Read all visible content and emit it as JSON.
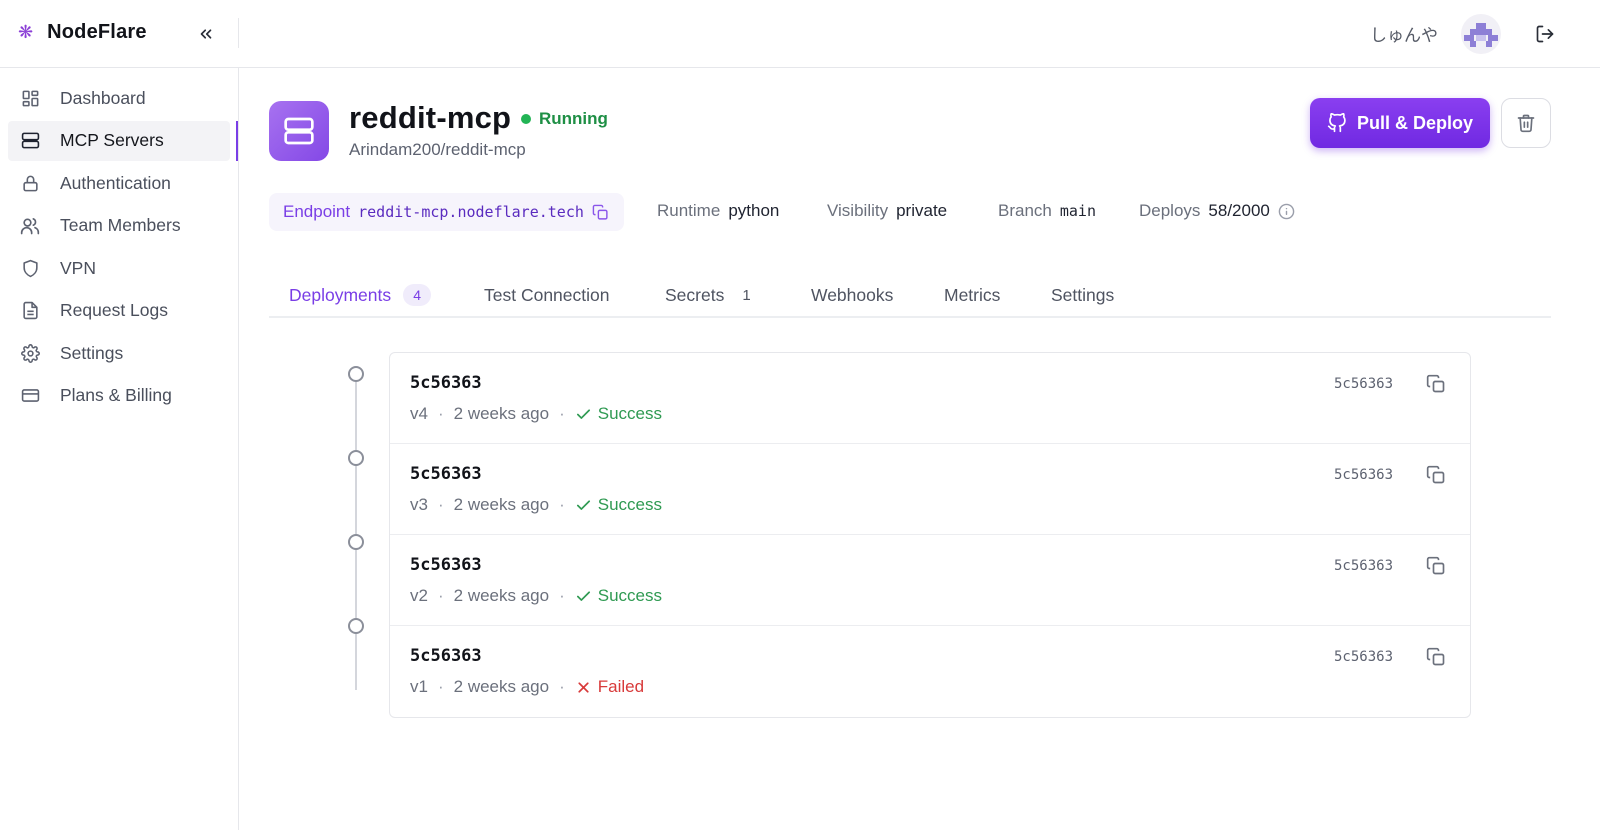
{
  "app": {
    "brand": "NodeFlare",
    "user_name": "しゅんや"
  },
  "sidebar": {
    "items": [
      {
        "label": "Dashboard",
        "icon": "dashboard-icon"
      },
      {
        "label": "MCP Servers",
        "icon": "server-icon",
        "active": true
      },
      {
        "label": "Authentication",
        "icon": "lock-icon"
      },
      {
        "label": "Team Members",
        "icon": "users-icon"
      },
      {
        "label": "VPN",
        "icon": "shield-icon"
      },
      {
        "label": "Request Logs",
        "icon": "file-text-icon"
      },
      {
        "label": "Settings",
        "icon": "gear-icon"
      },
      {
        "label": "Plans & Billing",
        "icon": "credit-card-icon"
      }
    ]
  },
  "server": {
    "name": "reddit-mcp",
    "status": "Running",
    "repo": "Arindam200/reddit-mcp",
    "deploy_button": "Pull & Deploy",
    "meta": {
      "endpoint_label": "Endpoint",
      "endpoint_value": "reddit-mcp.nodeflare.tech",
      "runtime_label": "Runtime",
      "runtime_value": "python",
      "visibility_label": "Visibility",
      "visibility_value": "private",
      "branch_label": "Branch",
      "branch_value": "main",
      "deploys_label": "Deploys",
      "deploys_value": "58/2000"
    }
  },
  "tabs": [
    {
      "label": "Deployments",
      "count": "4",
      "active": true
    },
    {
      "label": "Test Connection"
    },
    {
      "label": "Secrets",
      "count": "1"
    },
    {
      "label": "Webhooks"
    },
    {
      "label": "Metrics"
    },
    {
      "label": "Settings"
    }
  ],
  "deployments": [
    {
      "hash": "5c56363",
      "version": "v4",
      "time": "2 weeks ago",
      "status": "Success",
      "short": "5c56363"
    },
    {
      "hash": "5c56363",
      "version": "v3",
      "time": "2 weeks ago",
      "status": "Success",
      "short": "5c56363"
    },
    {
      "hash": "5c56363",
      "version": "v2",
      "time": "2 weeks ago",
      "status": "Success",
      "short": "5c56363"
    },
    {
      "hash": "5c56363",
      "version": "v1",
      "time": "2 weeks ago",
      "status": "Failed",
      "short": "5c56363"
    }
  ],
  "colors": {
    "accent": "#7a3ee6",
    "running": "#22b455",
    "success": "#2f9a52",
    "failed": "#d83a3a"
  }
}
